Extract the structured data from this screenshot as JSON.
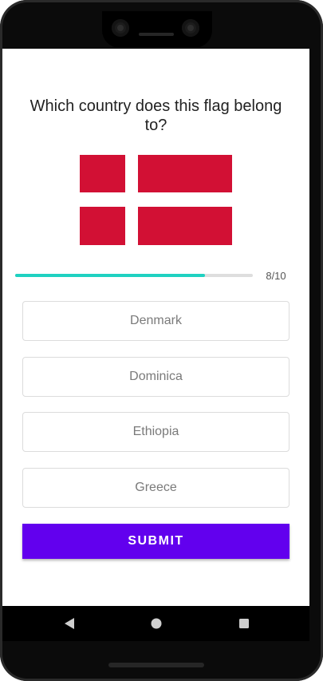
{
  "quiz": {
    "question": "Which country does this flag belong to?",
    "progress": {
      "current": 8,
      "total": 10,
      "label": "8/10",
      "fraction": 0.8
    },
    "options": [
      {
        "label": "Denmark"
      },
      {
        "label": "Dominica"
      },
      {
        "label": "Ethiopia"
      },
      {
        "label": "Greece"
      }
    ],
    "submit_label": "SUBMIT",
    "flag": {
      "name": "denmark-flag",
      "color": "#d21034"
    }
  },
  "colors": {
    "accent": "#6200ee",
    "progress": "#1fd1c1"
  },
  "navbar": {
    "back_icon": "back-triangle-icon",
    "home_icon": "home-circle-icon",
    "recent_icon": "recent-square-icon"
  }
}
